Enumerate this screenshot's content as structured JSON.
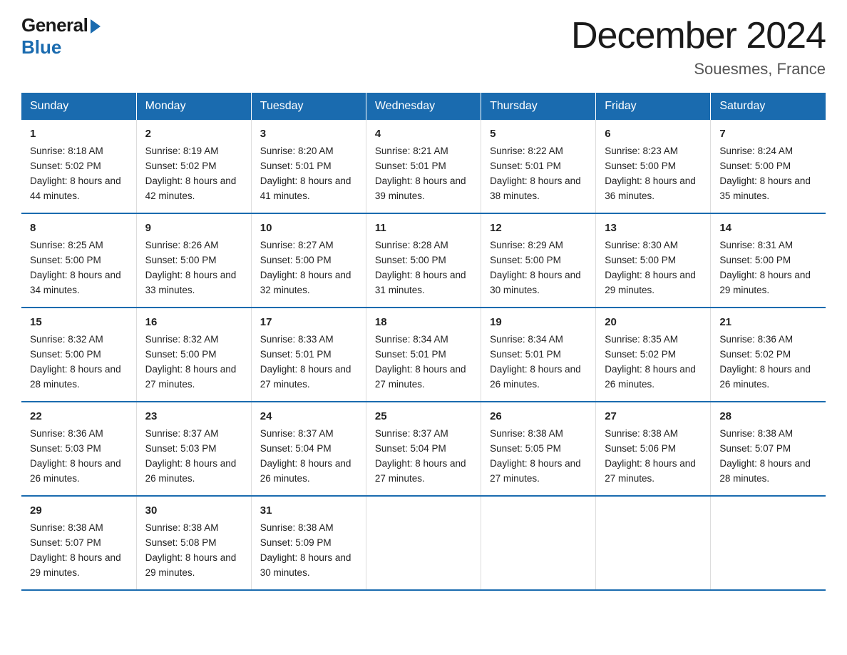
{
  "logo": {
    "general": "General",
    "blue": "Blue"
  },
  "title": "December 2024",
  "location": "Souesmes, France",
  "days_header": [
    "Sunday",
    "Monday",
    "Tuesday",
    "Wednesday",
    "Thursday",
    "Friday",
    "Saturday"
  ],
  "weeks": [
    [
      {
        "day": "1",
        "sunrise": "8:18 AM",
        "sunset": "5:02 PM",
        "daylight": "8 hours and 44 minutes."
      },
      {
        "day": "2",
        "sunrise": "8:19 AM",
        "sunset": "5:02 PM",
        "daylight": "8 hours and 42 minutes."
      },
      {
        "day": "3",
        "sunrise": "8:20 AM",
        "sunset": "5:01 PM",
        "daylight": "8 hours and 41 minutes."
      },
      {
        "day": "4",
        "sunrise": "8:21 AM",
        "sunset": "5:01 PM",
        "daylight": "8 hours and 39 minutes."
      },
      {
        "day": "5",
        "sunrise": "8:22 AM",
        "sunset": "5:01 PM",
        "daylight": "8 hours and 38 minutes."
      },
      {
        "day": "6",
        "sunrise": "8:23 AM",
        "sunset": "5:00 PM",
        "daylight": "8 hours and 36 minutes."
      },
      {
        "day": "7",
        "sunrise": "8:24 AM",
        "sunset": "5:00 PM",
        "daylight": "8 hours and 35 minutes."
      }
    ],
    [
      {
        "day": "8",
        "sunrise": "8:25 AM",
        "sunset": "5:00 PM",
        "daylight": "8 hours and 34 minutes."
      },
      {
        "day": "9",
        "sunrise": "8:26 AM",
        "sunset": "5:00 PM",
        "daylight": "8 hours and 33 minutes."
      },
      {
        "day": "10",
        "sunrise": "8:27 AM",
        "sunset": "5:00 PM",
        "daylight": "8 hours and 32 minutes."
      },
      {
        "day": "11",
        "sunrise": "8:28 AM",
        "sunset": "5:00 PM",
        "daylight": "8 hours and 31 minutes."
      },
      {
        "day": "12",
        "sunrise": "8:29 AM",
        "sunset": "5:00 PM",
        "daylight": "8 hours and 30 minutes."
      },
      {
        "day": "13",
        "sunrise": "8:30 AM",
        "sunset": "5:00 PM",
        "daylight": "8 hours and 29 minutes."
      },
      {
        "day": "14",
        "sunrise": "8:31 AM",
        "sunset": "5:00 PM",
        "daylight": "8 hours and 29 minutes."
      }
    ],
    [
      {
        "day": "15",
        "sunrise": "8:32 AM",
        "sunset": "5:00 PM",
        "daylight": "8 hours and 28 minutes."
      },
      {
        "day": "16",
        "sunrise": "8:32 AM",
        "sunset": "5:00 PM",
        "daylight": "8 hours and 27 minutes."
      },
      {
        "day": "17",
        "sunrise": "8:33 AM",
        "sunset": "5:01 PM",
        "daylight": "8 hours and 27 minutes."
      },
      {
        "day": "18",
        "sunrise": "8:34 AM",
        "sunset": "5:01 PM",
        "daylight": "8 hours and 27 minutes."
      },
      {
        "day": "19",
        "sunrise": "8:34 AM",
        "sunset": "5:01 PM",
        "daylight": "8 hours and 26 minutes."
      },
      {
        "day": "20",
        "sunrise": "8:35 AM",
        "sunset": "5:02 PM",
        "daylight": "8 hours and 26 minutes."
      },
      {
        "day": "21",
        "sunrise": "8:36 AM",
        "sunset": "5:02 PM",
        "daylight": "8 hours and 26 minutes."
      }
    ],
    [
      {
        "day": "22",
        "sunrise": "8:36 AM",
        "sunset": "5:03 PM",
        "daylight": "8 hours and 26 minutes."
      },
      {
        "day": "23",
        "sunrise": "8:37 AM",
        "sunset": "5:03 PM",
        "daylight": "8 hours and 26 minutes."
      },
      {
        "day": "24",
        "sunrise": "8:37 AM",
        "sunset": "5:04 PM",
        "daylight": "8 hours and 26 minutes."
      },
      {
        "day": "25",
        "sunrise": "8:37 AM",
        "sunset": "5:04 PM",
        "daylight": "8 hours and 27 minutes."
      },
      {
        "day": "26",
        "sunrise": "8:38 AM",
        "sunset": "5:05 PM",
        "daylight": "8 hours and 27 minutes."
      },
      {
        "day": "27",
        "sunrise": "8:38 AM",
        "sunset": "5:06 PM",
        "daylight": "8 hours and 27 minutes."
      },
      {
        "day": "28",
        "sunrise": "8:38 AM",
        "sunset": "5:07 PM",
        "daylight": "8 hours and 28 minutes."
      }
    ],
    [
      {
        "day": "29",
        "sunrise": "8:38 AM",
        "sunset": "5:07 PM",
        "daylight": "8 hours and 29 minutes."
      },
      {
        "day": "30",
        "sunrise": "8:38 AM",
        "sunset": "5:08 PM",
        "daylight": "8 hours and 29 minutes."
      },
      {
        "day": "31",
        "sunrise": "8:38 AM",
        "sunset": "5:09 PM",
        "daylight": "8 hours and 30 minutes."
      },
      null,
      null,
      null,
      null
    ]
  ],
  "labels": {
    "sunrise": "Sunrise:",
    "sunset": "Sunset:",
    "daylight": "Daylight:"
  }
}
